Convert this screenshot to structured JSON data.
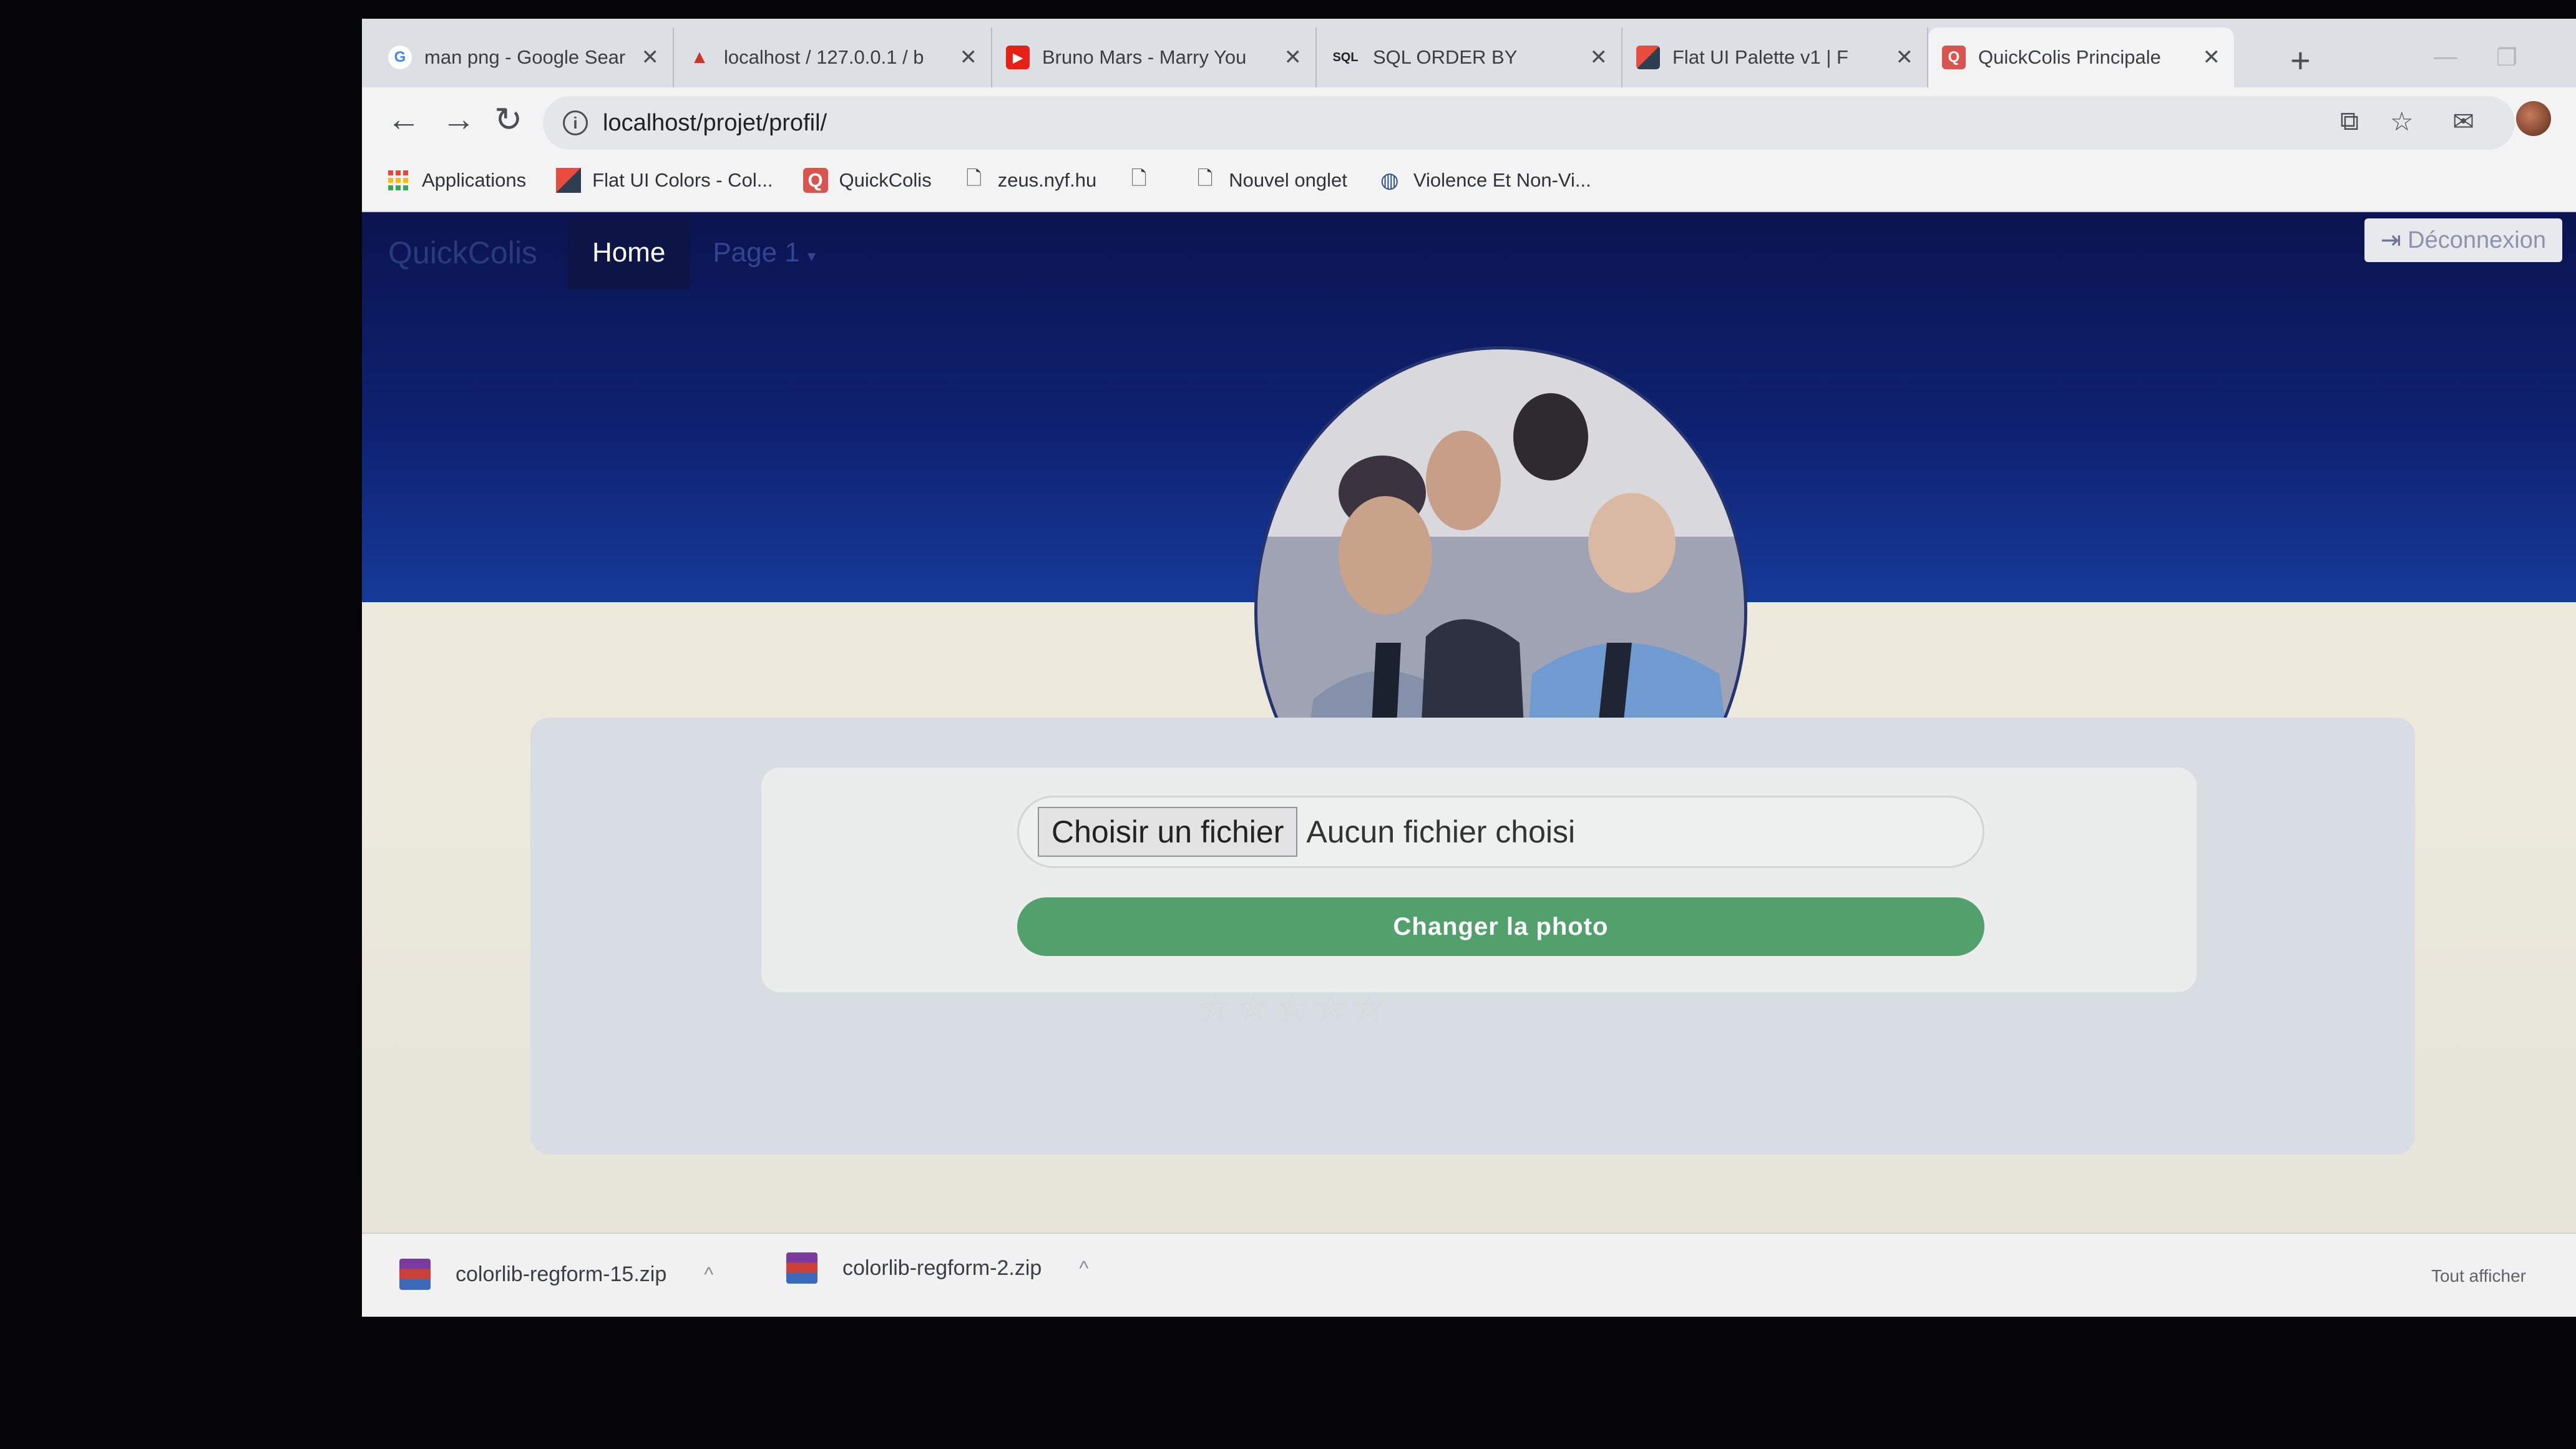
{
  "tabs": [
    {
      "label": "man png - Google Sear",
      "icon": "google-icon"
    },
    {
      "label": "localhost / 127.0.0.1 / b",
      "icon": "phpmyadmin-icon"
    },
    {
      "label": "Bruno Mars - Marry You",
      "icon": "youtube-icon"
    },
    {
      "label": "SQL ORDER BY",
      "icon": "sql-icon"
    },
    {
      "label": "Flat UI Palette v1 | F",
      "icon": "flatui-icon"
    },
    {
      "label": "QuickColis Principale",
      "icon": "quickcolis-icon",
      "active": true
    }
  ],
  "toolbar": {
    "url": "localhost/projet/profil/"
  },
  "bookmarks": [
    {
      "label": "Applications",
      "icon": "apps-grid-icon"
    },
    {
      "label": "Flat UI Colors - Col...",
      "icon": "flatui-icon"
    },
    {
      "label": "QuickColis",
      "icon": "quickcolis-icon"
    },
    {
      "label": "zeus.nyf.hu",
      "icon": "page-icon"
    },
    {
      "label": "",
      "icon": "page-icon"
    },
    {
      "label": "Nouvel onglet",
      "icon": "page-icon"
    },
    {
      "label": "Violence Et Non-Vi...",
      "icon": "globe-icon"
    }
  ],
  "navbar": {
    "brand": "QuickColis",
    "home": "Home",
    "page1": "Page 1",
    "logout": "Déconnexion"
  },
  "profile": {
    "file_button": "Choisir un fichier",
    "file_status": "Aucun fichier choisi",
    "submit": "Changer la photo",
    "rating_stars": "☆☆☆☆☆",
    "rating_value": 0,
    "rating_max": 5
  },
  "downloads": {
    "items": [
      "colorlib-regform-15.zip",
      "colorlib-regform-2.zip"
    ],
    "show_all": "Tout afficher"
  },
  "colors": {
    "hero_top": "#0b1450",
    "hero_bottom": "#163a9a",
    "submit_green": "#52a06b",
    "page_bg": "#ece8dc"
  }
}
